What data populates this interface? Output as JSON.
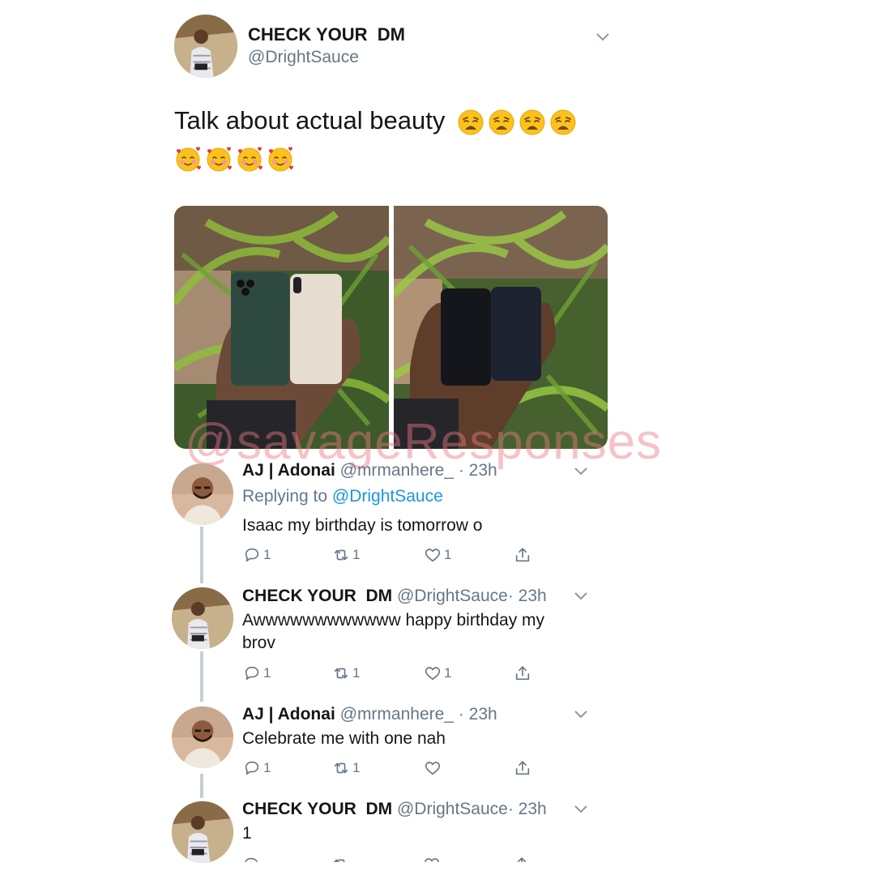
{
  "main_tweet": {
    "display_name": "CHECK YOUR  DM",
    "handle": "@DrightSauce",
    "text": "Talk about actual beauty",
    "emoji_line1": [
      "weary-face",
      "weary-face",
      "weary-face",
      "weary-face"
    ],
    "emoji_line2": [
      "smiling-face-with-hearts",
      "smiling-face-with-hearts",
      "smiling-face-with-hearts",
      "smiling-face-with-hearts"
    ]
  },
  "watermark": "@savageResponses",
  "replies": [
    {
      "display_name": "AJ | Adonai",
      "handle": "@mrmanhere_",
      "time": "· 23h",
      "replying_label": "Replying to",
      "replying_handle": "@DrightSauce",
      "text": "Isaac my birthday is tomorrow o",
      "reply_count": "1",
      "retweet_count": "1",
      "like_count": "1"
    },
    {
      "display_name": "CHECK YOUR  DM",
      "handle": "@DrightSauce",
      "time": "· 23h",
      "text": "Awwwwwwwwwwww happy birthday my brov",
      "reply_count": "1",
      "retweet_count": "1",
      "like_count": "1"
    },
    {
      "display_name": "AJ | Adonai",
      "handle": "@mrmanhere_",
      "time": "· 23h",
      "text": "Celebrate me with one nah",
      "reply_count": "1",
      "retweet_count": "1",
      "like_count": ""
    },
    {
      "display_name": "CHECK YOUR  DM",
      "handle": "@DrightSauce",
      "time": "· 23h",
      "text": "1"
    }
  ],
  "colors": {
    "muted": "#657786",
    "link": "#1b95e0",
    "thread_line": "#c4cfd6"
  }
}
